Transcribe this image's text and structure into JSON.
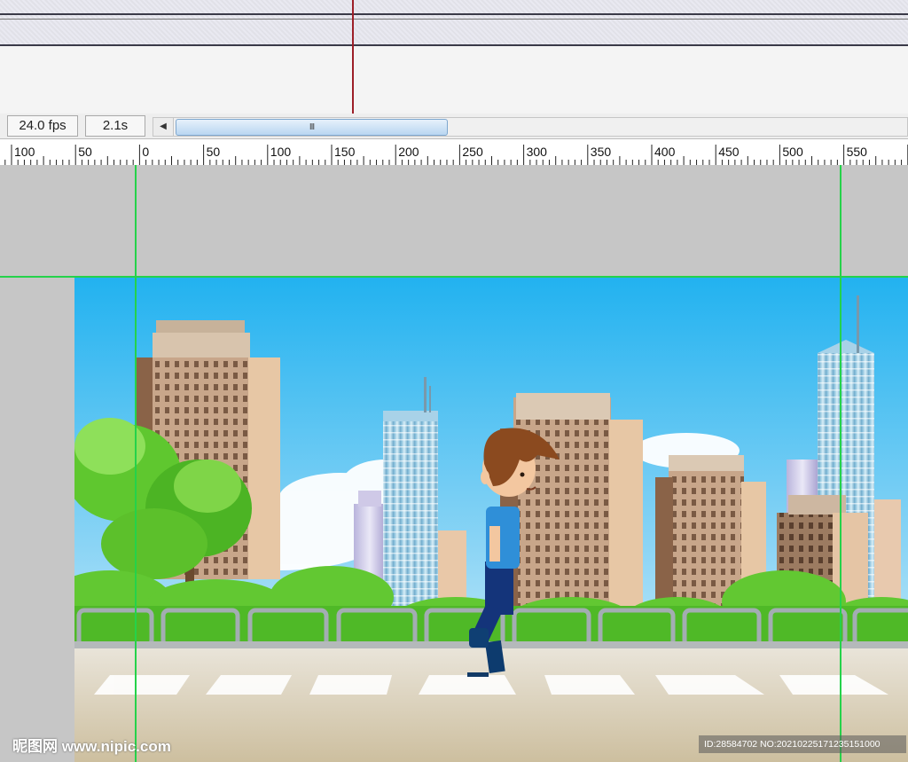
{
  "timeline": {
    "fps_label": "24.0 fps",
    "time_label": "2.1s",
    "scroll_left_arrow": "◀",
    "scroll_grip": "III",
    "accent_playhead": "#9d1f28"
  },
  "ruler": {
    "labels": [
      "100",
      "50",
      "0",
      "50",
      "100",
      "150",
      "200",
      "250",
      "300",
      "350",
      "400",
      "450",
      "500",
      "550"
    ]
  },
  "guides": {
    "color": "#25d24a"
  },
  "stage": {
    "scene": "city street with walking boy",
    "colors": {
      "sky_top": "#27b4f0",
      "sky_bottom": "#d9f1fb",
      "road": "#d8ccb4",
      "tree": "#5fc72f"
    }
  },
  "watermark": {
    "left": "昵图网 www.nipic.com",
    "right": "ID:28584702 NO:20210225171235151000"
  }
}
